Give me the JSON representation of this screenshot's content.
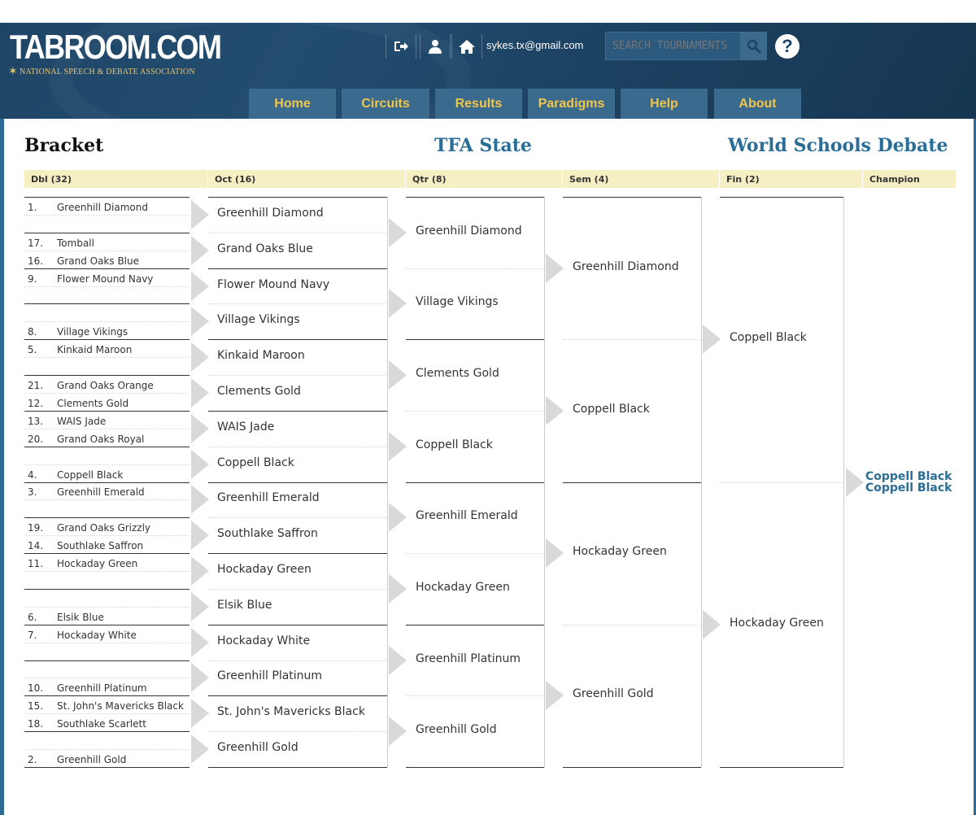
{
  "header": {
    "logo_text": "TABROOM.COM",
    "tagline": "NATIONAL SPEECH & DEBATE ASSOCIATION",
    "email": "sykes.tx@gmail.com",
    "search_placeholder": "SEARCH TOURNAMENTS",
    "help_glyph": "?",
    "icons": [
      "logout-icon",
      "user-icon",
      "home-icon",
      "search-icon",
      "help-icon"
    ],
    "nav": [
      "Home",
      "Circuits",
      "Results",
      "Paradigms",
      "Help",
      "About"
    ],
    "colors": {
      "header_bg": "#1f4566",
      "nav_bg": "#3a6a8d",
      "nav_text": "#f0c64a",
      "accent": "#2a6e97",
      "round_header_bg": "#f7efc4"
    }
  },
  "page": {
    "title": "Bracket",
    "tournament": "TFA State",
    "event": "World Schools Debate"
  },
  "rounds": [
    "Dbl (32)",
    "Oct (16)",
    "Qtr (8)",
    "Sem (4)",
    "Fin (2)",
    "Champion"
  ],
  "doubles": [
    {
      "seed": "1.",
      "team": "Greenhill Diamond"
    },
    {
      "seed": "",
      "team": ""
    },
    {
      "seed": "17.",
      "team": "Tomball"
    },
    {
      "seed": "16.",
      "team": "Grand Oaks Blue"
    },
    {
      "seed": "9.",
      "team": "Flower Mound Navy"
    },
    {
      "seed": "",
      "team": ""
    },
    {
      "seed": "",
      "team": ""
    },
    {
      "seed": "8.",
      "team": "Village Vikings"
    },
    {
      "seed": "5.",
      "team": "Kinkaid Maroon"
    },
    {
      "seed": "",
      "team": ""
    },
    {
      "seed": "21.",
      "team": "Grand Oaks Orange"
    },
    {
      "seed": "12.",
      "team": "Clements Gold"
    },
    {
      "seed": "13.",
      "team": "WAIS Jade"
    },
    {
      "seed": "20.",
      "team": "Grand Oaks Royal"
    },
    {
      "seed": "",
      "team": ""
    },
    {
      "seed": "4.",
      "team": "Coppell Black"
    },
    {
      "seed": "3.",
      "team": "Greenhill Emerald"
    },
    {
      "seed": "",
      "team": ""
    },
    {
      "seed": "19.",
      "team": "Grand Oaks Grizzly"
    },
    {
      "seed": "14.",
      "team": "Southlake Saffron"
    },
    {
      "seed": "11.",
      "team": "Hockaday Green"
    },
    {
      "seed": "",
      "team": ""
    },
    {
      "seed": "",
      "team": ""
    },
    {
      "seed": "6.",
      "team": "Elsik Blue"
    },
    {
      "seed": "7.",
      "team": "Hockaday White"
    },
    {
      "seed": "",
      "team": ""
    },
    {
      "seed": "",
      "team": ""
    },
    {
      "seed": "10.",
      "team": "Greenhill Platinum"
    },
    {
      "seed": "15.",
      "team": "St. John's Mavericks Black"
    },
    {
      "seed": "18.",
      "team": "Southlake Scarlett"
    },
    {
      "seed": "",
      "team": ""
    },
    {
      "seed": "2.",
      "team": "Greenhill Gold"
    }
  ],
  "octos": [
    "Greenhill Diamond",
    "Grand Oaks Blue",
    "Flower Mound Navy",
    "Village Vikings",
    "Kinkaid Maroon",
    "Clements Gold",
    "WAIS Jade",
    "Coppell Black",
    "Greenhill Emerald",
    "Southlake Saffron",
    "Hockaday Green",
    "Elsik Blue",
    "Hockaday White",
    "Greenhill Platinum",
    "St. John's Mavericks Black",
    "Greenhill Gold"
  ],
  "quarters": [
    "Greenhill Diamond",
    "Village Vikings",
    "Clements Gold",
    "Coppell Black",
    "Greenhill Emerald",
    "Hockaday Green",
    "Greenhill Platinum",
    "Greenhill Gold"
  ],
  "semis": [
    "Greenhill Diamond",
    "Coppell Black",
    "Hockaday Green",
    "Greenhill Gold"
  ],
  "finals": [
    "Coppell Black",
    "Hockaday Green"
  ],
  "champion": [
    "Coppell Black",
    "Coppell Black"
  ]
}
